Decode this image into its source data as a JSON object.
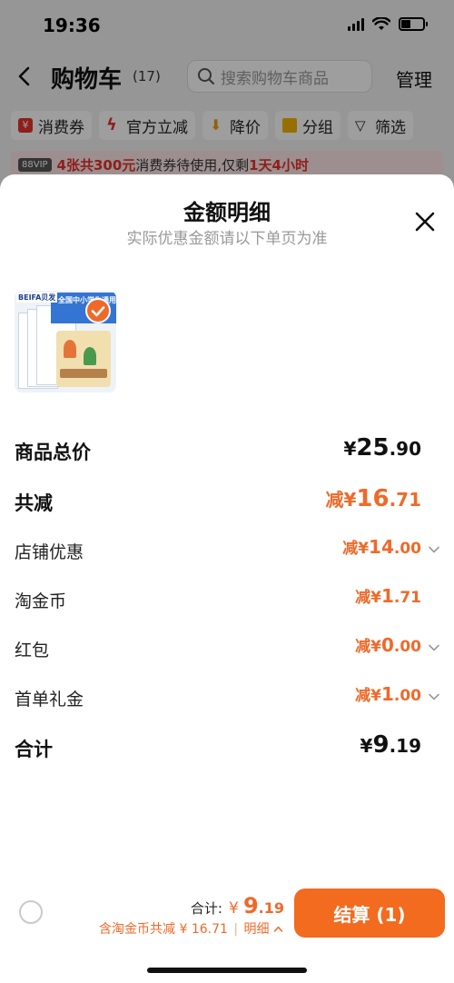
{
  "status_bar": {
    "time": "19:36"
  },
  "nav": {
    "title": "购物车",
    "count": "(17)",
    "search_placeholder": "搜索购物车商品",
    "manage": "管理"
  },
  "chips": [
    {
      "label": "消费券",
      "icon": "coupon-icon"
    },
    {
      "label": "官方立减",
      "icon": "lightning-icon"
    },
    {
      "label": "降价",
      "icon": "price-drop-icon"
    },
    {
      "label": "分组",
      "icon": "folder-icon"
    },
    {
      "label": "筛选",
      "icon": "filter-icon"
    }
  ],
  "vip_bar": {
    "badge": "88VIP",
    "highlight": "4张共300元",
    "text": "消费券待使用,仅剩",
    "time_left": "1天4小时"
  },
  "sheet": {
    "title": "金额明细",
    "subtitle": "实际优惠金额请以下单页为准",
    "product": {
      "brand": "BEIFA贝发",
      "cover_text": "全国中小学生通用"
    },
    "rows": [
      {
        "label": "商品总价",
        "prefix": "",
        "yen": "¥",
        "int": "25",
        "dec": ".90",
        "expandable": false
      },
      {
        "label": "共减",
        "prefix": "减",
        "yen": "¥",
        "int": "16",
        "dec": ".71",
        "expandable": false
      },
      {
        "label": "店铺优惠",
        "prefix": "减",
        "yen": "¥",
        "int": "14",
        "dec": ".00",
        "expandable": true
      },
      {
        "label": "淘金币",
        "prefix": "减",
        "yen": "¥",
        "int": "1",
        "dec": ".71",
        "expandable": false
      },
      {
        "label": "红包",
        "prefix": "减",
        "yen": "¥",
        "int": "0",
        "dec": ".00",
        "expandable": true
      },
      {
        "label": "首单礼金",
        "prefix": "减",
        "yen": "¥",
        "int": "1",
        "dec": ".00",
        "expandable": true
      },
      {
        "label": "合计",
        "prefix": "",
        "yen": "¥",
        "int": "9",
        "dec": ".19",
        "expandable": false
      }
    ]
  },
  "bottom_bar": {
    "total_label": "合计:",
    "total_yen": "¥",
    "total_int": "9",
    "total_dec": ".19",
    "discount_text": "含淘金币共减 ¥ 16.71",
    "separator": "|",
    "detail_label": "明细",
    "detail_arrow": "^",
    "checkout_label": "结算 (1)"
  },
  "colors": {
    "accent": "#ee6a2a",
    "checkout": "#f26b1f",
    "coupon_red": "#e5322d"
  }
}
